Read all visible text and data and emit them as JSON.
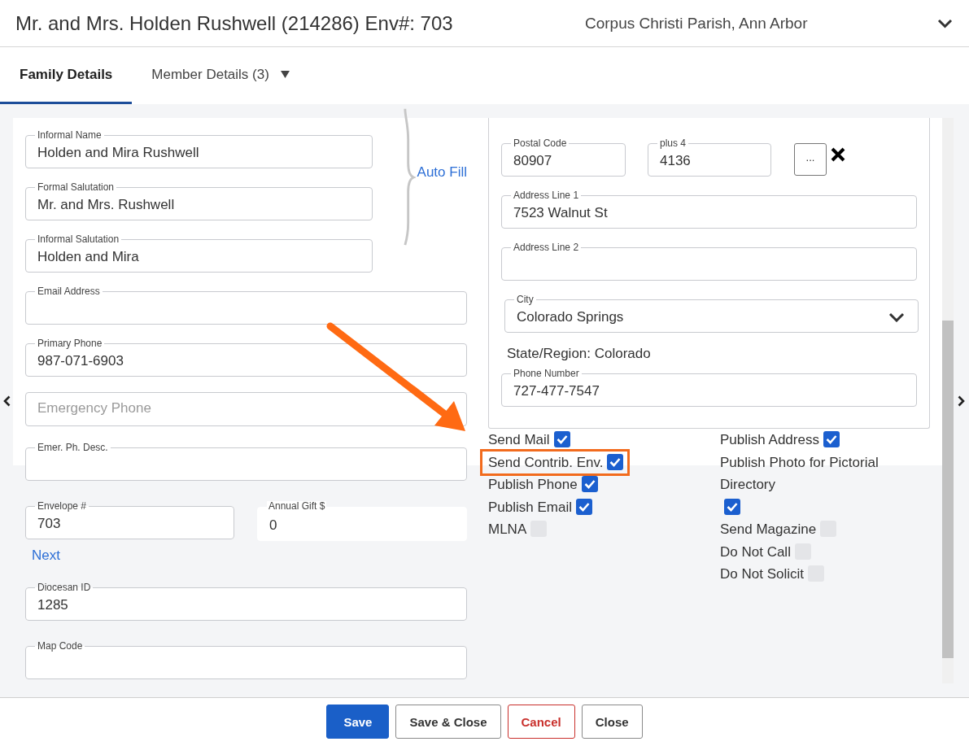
{
  "header": {
    "title": "Mr. and Mrs. Holden Rushwell (214286) Env#: 703",
    "parish": "Corpus Christi Parish, Ann Arbor"
  },
  "tabs": [
    {
      "label": "Family Details",
      "selected": true,
      "has_menu": false
    },
    {
      "label": "Member Details (3)",
      "selected": false,
      "has_menu": true
    }
  ],
  "name_fields": [
    {
      "label": "Informal Name",
      "value": "Holden and Mira Rushwell"
    },
    {
      "label": "Formal Salutation",
      "value": "Mr. and Mrs. Rushwell"
    },
    {
      "label": "Informal Salutation",
      "value": "Holden and Mira"
    }
  ],
  "auto_fill": "Auto Fill",
  "contact_fields": [
    {
      "label": "Email Address"
    },
    {
      "label": "Primary Phone",
      "value": "987-071-6903"
    },
    {
      "placeholder": "Emergency Phone"
    },
    {
      "label": "Emer. Ph. Desc."
    }
  ],
  "gift_row": [
    {
      "kind": "outlined",
      "label": "Envelope #",
      "value": "703"
    },
    {
      "kind": "plain",
      "label": "Annual Gift $",
      "value": "0"
    }
  ],
  "next_link": "Next",
  "other_fields": [
    {
      "label": "Diocesan ID",
      "value": "1285"
    },
    {
      "label": "Map Code"
    }
  ],
  "address": {
    "postal_code": {
      "label": "Postal Code",
      "value": "80907"
    },
    "plus4": {
      "label": "plus 4",
      "value": "4136"
    },
    "lookup_button": "...",
    "line1": {
      "label": "Address Line 1",
      "value": "7523 Walnut St"
    },
    "line2": {
      "label": "Address Line 2"
    },
    "city": {
      "label": "City",
      "value": "Colorado Springs"
    },
    "state_region": "State/Region: Colorado",
    "phone": {
      "label": "Phone Number",
      "value": "727-477-7547"
    }
  },
  "options_left": [
    {
      "label": "Send Mail",
      "checked": true,
      "highlighted": false
    },
    {
      "label": "Send Contrib. Env.",
      "checked": true,
      "highlighted": true
    },
    {
      "label": "Publish Phone",
      "checked": true,
      "highlighted": false
    },
    {
      "label": "Publish Email",
      "checked": true,
      "highlighted": false
    },
    {
      "label": "MLNA",
      "checked": false,
      "highlighted": false
    }
  ],
  "options_right": [
    {
      "label": "Publish Address",
      "checked": true,
      "highlighted": false
    },
    {
      "label": "Publish Photo for Pictorial Directory",
      "checked": true,
      "highlighted": false
    },
    {
      "label": "Send Magazine",
      "checked": false,
      "highlighted": false
    },
    {
      "label": "Do Not Call",
      "checked": false,
      "highlighted": false
    },
    {
      "label": "Do Not Solicit",
      "checked": false,
      "highlighted": false
    }
  ],
  "buttons": [
    {
      "label": "Save",
      "kind": "primary"
    },
    {
      "label": "Save & Close",
      "kind": "secondary"
    },
    {
      "label": "Cancel",
      "kind": "danger"
    },
    {
      "label": "Close",
      "kind": "secondary"
    }
  ]
}
